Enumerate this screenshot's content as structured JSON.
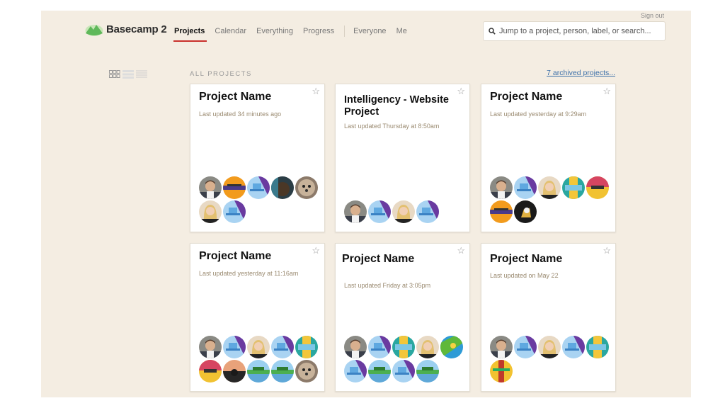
{
  "header": {
    "sign_out": "Sign out",
    "app_name": "Basecamp 2",
    "nav": [
      "Projects",
      "Calendar",
      "Everything",
      "Progress"
    ],
    "nav_right": [
      "Everyone",
      "Me"
    ],
    "search_placeholder": "Jump to a project, person, label, or search..."
  },
  "main": {
    "section_label": "ALL PROJECTS",
    "archived_link": "7 archived projects..."
  },
  "projects": [
    {
      "title": "Project Name",
      "updated": "Last updated 34 minutes ago",
      "avatars": [
        "man",
        "orange",
        "blue-purple",
        "dark-dog",
        "dog",
        "woman",
        "blue-purple"
      ]
    },
    {
      "title": "Intelligency - Website Project",
      "updated": "Last updated Thursday at 8:50am",
      "avatars": [
        "man",
        "blue-purple",
        "woman",
        "blue-purple"
      ]
    },
    {
      "title": "Project Name",
      "updated": "Last updated yesterday at 9:29am",
      "avatars": [
        "man",
        "blue-purple",
        "woman",
        "teal",
        "pink",
        "orange",
        "dark-cat"
      ]
    },
    {
      "title": "Project Name",
      "updated": "Last updated yesterday at 11:16am",
      "avatars": [
        "man",
        "blue-purple",
        "woman",
        "blue-purple",
        "teal",
        "pink",
        "sunset",
        "landscape",
        "landscape",
        "dog"
      ]
    },
    {
      "title": "Project Name",
      "updated": "Last updated Friday at 3:05pm",
      "avatars": [
        "man",
        "blue-purple",
        "teal",
        "woman",
        "green",
        "blue-purple",
        "landscape",
        "blue-purple",
        "landscape"
      ]
    },
    {
      "title": "Project Name",
      "updated": "Last updated on May 22",
      "avatars": [
        "man",
        "blue-purple",
        "woman",
        "blue-purple",
        "teal",
        "yellow"
      ]
    }
  ],
  "icons": {
    "search": "search-icon",
    "star": "star-icon",
    "logo": "mountain-logo-icon"
  },
  "colors": {
    "background": "#f4ede2",
    "active_underline": "#c9302c",
    "link": "#3a6ea8"
  }
}
